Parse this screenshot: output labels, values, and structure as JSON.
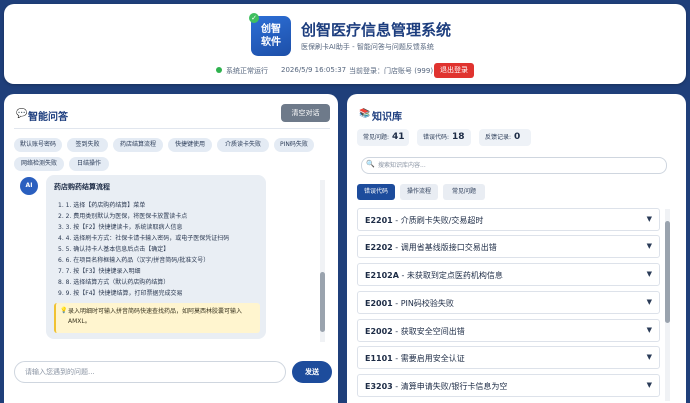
{
  "header": {
    "logo_line1": "创智",
    "logo_line2": "软件",
    "title": "创智医疗信息管理系统",
    "subtitle": "医保刷卡AI助手 - 智能问答与问题反馈系统",
    "status": "系统正常运行",
    "datetime": "2026/5/9 16:05:37",
    "login_info": "当前登录：门店账号 (999)",
    "logout_label": "退出登录"
  },
  "qa": {
    "title": "智能问答",
    "clear_label": "清空对话",
    "chips": [
      "默认账号密码",
      "签到失败",
      "药店结算流程",
      "快捷键使用",
      "介质读卡失败",
      "PIN码失败",
      "网络检测失败",
      "日结操作"
    ],
    "ai_label": "AI",
    "bubble_title": "药店购药结算流程",
    "steps": [
      "1. 1. 选择【药店购药结算】菜单",
      "2. 2. 费用类别默认为医保，将医保卡放置读卡点",
      "3. 3. 按【F2】快捷键读卡，系统读取病人信息",
      "4. 4. 选择刷卡方式：社保卡请卡输入密码，或电子医保凭证扫码",
      "5. 5. 确认持卡人基本信息后点击【确定】",
      "6. 6. 在项目名称框输入药品（汉字/拼音简码/批准文号）",
      "7. 7. 按【F3】快捷键录入明细",
      "8. 8. 选择结算方式（默认药店购药结算）",
      "9. 9. 按【F4】快捷键结算，打印票据完成交易"
    ],
    "tip_icon": "lightbulb-icon",
    "tip": "录入明细时可输入拼音简码快速查找药品，如阿莫西林胶囊可输入AMXL。",
    "input_placeholder": "请输入您遇到的问题...",
    "send_label": "发送"
  },
  "kb": {
    "title": "知识库",
    "stats": [
      {
        "label": "常见问题:",
        "value": "41"
      },
      {
        "label": "错误代码:",
        "value": "18"
      },
      {
        "label": "反馈记录:",
        "value": "0"
      }
    ],
    "search_placeholder": "搜索知识库内容...",
    "tabs": [
      "错误代码",
      "操作流程",
      "常见问题"
    ],
    "active_tab": "错误代码",
    "items": [
      {
        "code": "E2201",
        "desc": " - 介质刷卡失败/交易超时"
      },
      {
        "code": "E2202",
        "desc": " - 调用省基线版接口交易出错"
      },
      {
        "code": "E2102A",
        "desc": " - 未获取到定点医药机构信息"
      },
      {
        "code": "E2001",
        "desc": " - PIN码校验失败"
      },
      {
        "code": "E2002",
        "desc": " - 获取安全空间出错"
      },
      {
        "code": "E1101",
        "desc": " - 需要启用安全认证"
      },
      {
        "code": "E3203",
        "desc": " - 清算申请失败/银行卡信息为空"
      }
    ]
  },
  "colors": {
    "background": "#1f3f7a",
    "primary": "#1d4c9c",
    "danger": "#e0332f",
    "status_ok": "#2fb24e"
  }
}
